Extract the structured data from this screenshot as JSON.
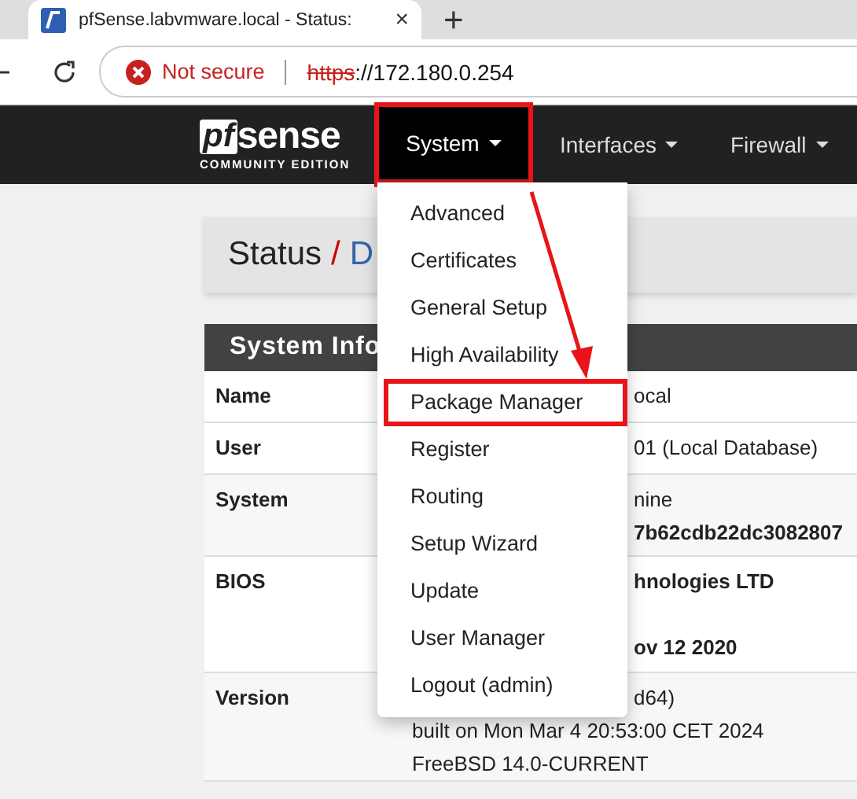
{
  "browser": {
    "tab": {
      "title": "pfSense.labvmware.local - Status:",
      "close": "×"
    },
    "new_tab": "+",
    "address": {
      "security": "Not secure",
      "scheme": "https",
      "rest": "://172.180.0.254"
    }
  },
  "logo": {
    "mark": "pf",
    "name": "sense",
    "edition": "COMMUNITY EDITION"
  },
  "nav": [
    {
      "label": "System",
      "selected": true,
      "outlined": true
    },
    {
      "label": "Interfaces",
      "selected": false,
      "outlined": false
    },
    {
      "label": "Firewall",
      "selected": false,
      "outlined": false
    }
  ],
  "menu": [
    {
      "label": "Advanced",
      "outlined": false
    },
    {
      "label": "Certificates",
      "outlined": false
    },
    {
      "label": "General Setup",
      "outlined": false
    },
    {
      "label": "High Availability",
      "outlined": false
    },
    {
      "label": "Package Manager",
      "outlined": true
    },
    {
      "label": "Register",
      "outlined": false
    },
    {
      "label": "Routing",
      "outlined": false
    },
    {
      "label": "Setup Wizard",
      "outlined": false
    },
    {
      "label": "Update",
      "outlined": false
    },
    {
      "label": "User Manager",
      "outlined": false
    },
    {
      "label": "Logout (admin)",
      "outlined": false
    }
  ],
  "breadcrumb": {
    "section": "Status",
    "separator": "/",
    "page": "D"
  },
  "panel": {
    "title": "System Info",
    "rows": [
      {
        "label": "Name",
        "lines": [
          {
            "text": "ocal",
            "kind": "cut",
            "bold": false
          }
        ]
      },
      {
        "label": "User",
        "lines": [
          {
            "text": "01 (Local Database)",
            "kind": "cut",
            "bold": false
          }
        ]
      },
      {
        "label": "System",
        "lines": [
          {
            "text": "nine",
            "kind": "cut",
            "bold": false
          },
          {
            "text": "7b62cdb22dc3082807",
            "kind": "cut",
            "bold": true
          }
        ]
      },
      {
        "label": "BIOS",
        "lines": [
          {
            "text": "hnologies LTD",
            "kind": "cut",
            "bold": true
          },
          {
            "text": "ov 12 2020",
            "kind": "cut",
            "bold": true
          }
        ]
      },
      {
        "label": "Version",
        "lines": [
          {
            "text": "d64)",
            "kind": "cut",
            "bold": false
          },
          {
            "text": "built on Mon Mar 4 20:53:00 CET 2024",
            "kind": "full",
            "bold": false
          },
          {
            "text": "FreeBSD 14.0-CURRENT",
            "kind": "full",
            "bold": false
          }
        ]
      }
    ]
  }
}
